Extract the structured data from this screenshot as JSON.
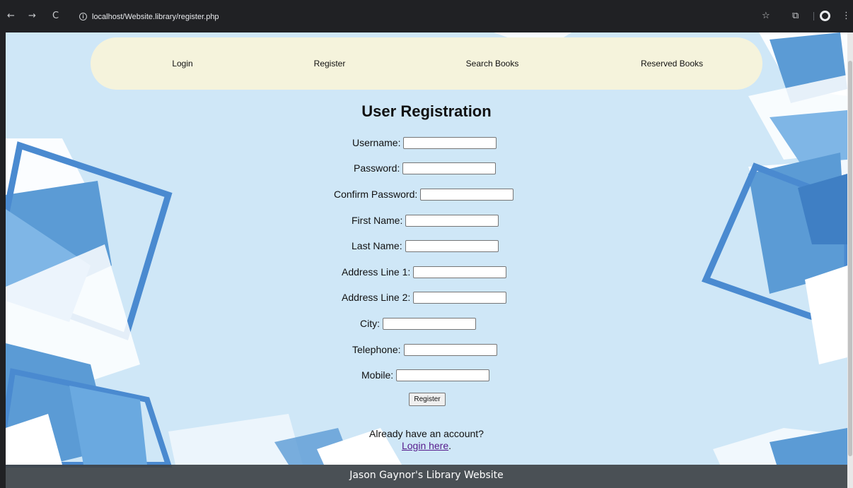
{
  "browser": {
    "back_icon": "←",
    "forward_icon": "→",
    "reload_icon": "C",
    "url": "localhost/Website.library/register.php",
    "bookmark_icon": "☆",
    "extensions_icon": "⧉",
    "menu_icon": "⋮"
  },
  "nav": {
    "items": [
      {
        "label": "Login"
      },
      {
        "label": "Register"
      },
      {
        "label": "Search Books"
      },
      {
        "label": "Reserved Books"
      }
    ]
  },
  "form": {
    "title": "User Registration",
    "fields": [
      {
        "label": "Username:",
        "value": ""
      },
      {
        "label": "Password:",
        "value": ""
      },
      {
        "label": "Confirm Password:",
        "value": ""
      },
      {
        "label": "First Name:",
        "value": ""
      },
      {
        "label": "Last Name:",
        "value": ""
      },
      {
        "label": "Address Line 1:",
        "value": ""
      },
      {
        "label": "Address Line 2:",
        "value": ""
      },
      {
        "label": "City:",
        "value": ""
      },
      {
        "label": "Telephone:",
        "value": ""
      },
      {
        "label": "Mobile:",
        "value": ""
      }
    ],
    "submit_label": "Register",
    "already_text": "Already have an account?",
    "login_link": "Login here",
    "login_suffix": "."
  },
  "footer": {
    "text": "Jason Gaynor's Library Website"
  },
  "colors": {
    "page_bg": "#cfe7f7",
    "navbar_bg": "#f5f3dc",
    "footer_bg": "#404448",
    "deco_blue": "#5b9bd5"
  }
}
